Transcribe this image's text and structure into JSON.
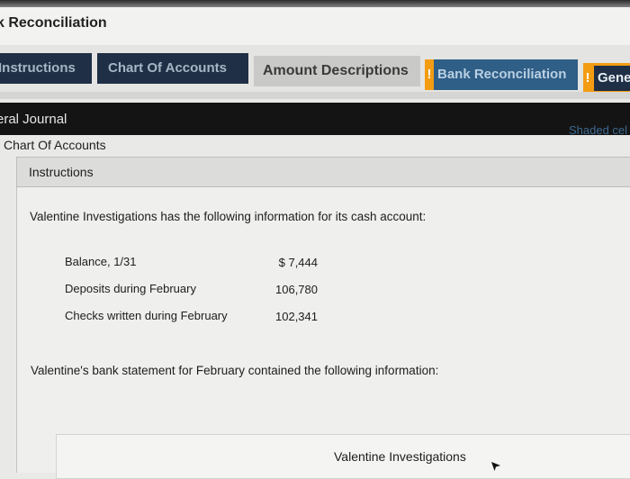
{
  "window": {
    "title": "k Reconciliation"
  },
  "tabs": [
    {
      "label": "Instructions"
    },
    {
      "label": "Chart Of Accounts"
    },
    {
      "label": "Amount Descriptions"
    },
    {
      "label": "Bank Reconciliation",
      "alert": "!"
    },
    {
      "label": "Gene",
      "alert": "!"
    }
  ],
  "subtabs": {
    "journal": "eral Journal",
    "shaded_note": "Shaded cel",
    "chart_of_accounts": "Chart Of Accounts"
  },
  "instructions": {
    "title": "Instructions",
    "intro": "Valentine Investigations has the following information for its cash account:",
    "rows": [
      {
        "label": "Balance, 1/31",
        "value": "$ 7,444"
      },
      {
        "label": "Deposits during February",
        "value": "106,780"
      },
      {
        "label": "Checks written during February",
        "value": "102,341"
      }
    ],
    "statement": "Valentine's bank statement for February contained the following information:",
    "table_heading": "Valentine Investigations"
  },
  "colors": {
    "dark_tab": "#1f2f45",
    "alert": "#f39c12",
    "link": "#3d6a92"
  },
  "icons": {
    "cursor": "mouse-pointer-icon"
  }
}
